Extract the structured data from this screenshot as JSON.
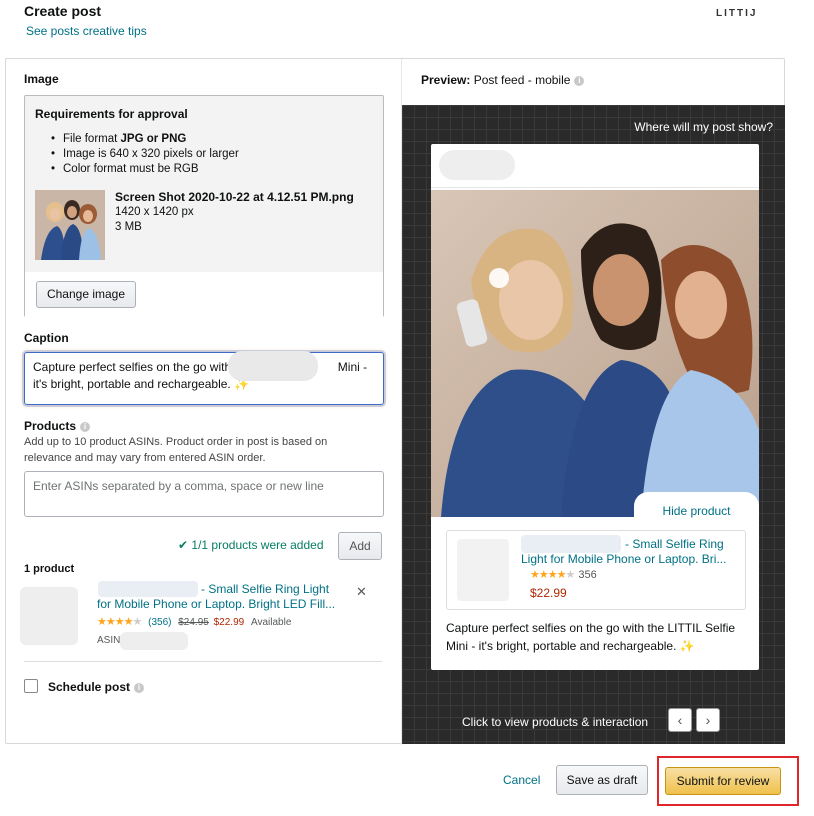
{
  "header": {
    "title": "Create post",
    "tips_link": "See posts creative tips",
    "brand": "LITTIJ"
  },
  "image_section": {
    "label": "Image",
    "requirements_title": "Requirements for approval",
    "requirements": [
      {
        "text": "File format ",
        "bold": "JPG or PNG"
      },
      {
        "text": "Image is 640 x 320 pixels or larger",
        "bold": ""
      },
      {
        "text": "Color format must be RGB",
        "bold": ""
      }
    ],
    "file_name": "Screen Shot 2020-10-22 at 4.12.51 PM.png",
    "file_dimensions": "1420 x 1420 px",
    "file_size": "3 MB",
    "change_button": "Change image"
  },
  "caption_section": {
    "label": "Caption",
    "text_part1": "Capture perfect selfies on the go with t",
    "text_part2": "Mini -",
    "text_part3": "it's bright, portable and rechargeable.",
    "sparkle": "✨"
  },
  "products_section": {
    "label": "Products",
    "help_text": "Add up to 10 product ASINs. Product order in post is based on relevance and may vary from entered ASIN order.",
    "input_placeholder": "Enter ASINs separated by a comma, space or new line",
    "added_message": "1/1 products were added",
    "add_button": "Add",
    "count_label": "1 product",
    "product": {
      "name_line1": "- Small Selfie Ring Light",
      "name_line2": "for Mobile Phone or Laptop. Bright LED Fill...",
      "stars_filled": 4,
      "reviews": "(356)",
      "list_price": "$24.95",
      "price": "$22.99",
      "availability": "Available",
      "asin_label": "ASIN:"
    }
  },
  "schedule": {
    "label": "Schedule post"
  },
  "preview": {
    "label_bold": "Preview:",
    "label_rest": "Post feed - mobile",
    "where_link": "Where will my post show?",
    "hide_product": "Hide product",
    "product_name_line1": "- Small Selfie Ring",
    "product_name_line2": "Light for Mobile Phone or Laptop. Bri...",
    "product_rating_count": "356",
    "product_price": "$22.99",
    "caption": "Capture perfect selfies on the go with the LITTIL Selfie Mini - it's bright, portable and rechargeable.",
    "caption_sparkle": "✨",
    "click_text": "Click to view products & interaction",
    "prev_arrow": "‹",
    "next_arrow": "›"
  },
  "footer": {
    "cancel": "Cancel",
    "save_draft": "Save as draft",
    "submit": "Submit for review"
  },
  "colors": {
    "link": "#007185",
    "price": "#B12704",
    "success": "#067D62",
    "submit_button": "#F0C14B",
    "highlight_border": "#E0262A",
    "preview_background": "#2A2A2A"
  }
}
